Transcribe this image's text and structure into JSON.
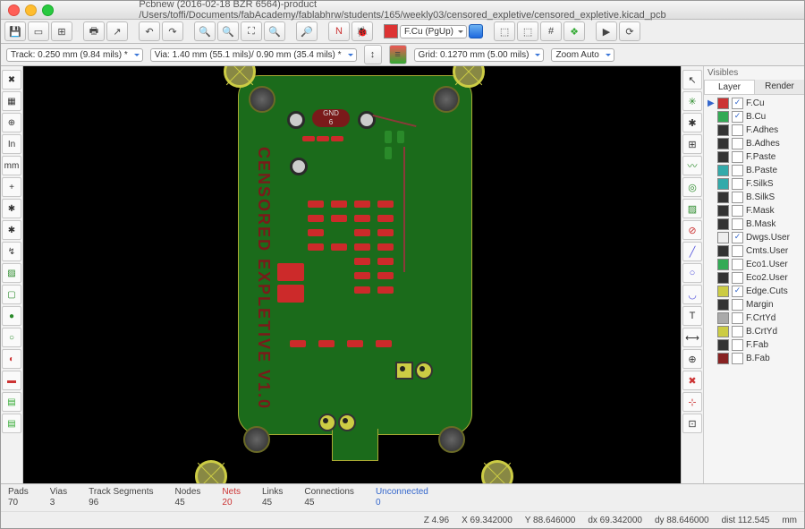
{
  "title": "Pcbnew (2016-02-18 BZR 6564)-product /Users/toffi/Documents/fabAcademy/fablabhrw/students/165/weekly03/censored_expletive/censored_expletive.kicad_pcb",
  "layer_selector": "F.Cu (PgUp)",
  "track_combo": "Track: 0.250 mm (9.84 mils) *",
  "via_combo": "Via: 1.40 mm (55.1 mils)/ 0.90 mm (35.4 mils) *",
  "grid_combo": "Grid: 0.1270 mm (5.00 mils)",
  "zoom_combo": "Zoom Auto",
  "gnd_label_1": "GND",
  "gnd_label_2": "6",
  "board_text": "CENSORED EXPLETIVE V1.0",
  "visibles_title": "Visibles",
  "tab_layer": "Layer",
  "tab_render": "Render",
  "layers": [
    {
      "name": "F.Cu",
      "color": "#cc3333",
      "checked": true,
      "active": true
    },
    {
      "name": "B.Cu",
      "color": "#33aa55",
      "checked": true
    },
    {
      "name": "F.Adhes",
      "color": "#333333",
      "checked": false
    },
    {
      "name": "B.Adhes",
      "color": "#333333",
      "checked": false
    },
    {
      "name": "F.Paste",
      "color": "#333333",
      "checked": false
    },
    {
      "name": "B.Paste",
      "color": "#33aaaa",
      "checked": false
    },
    {
      "name": "F.SilkS",
      "color": "#33aaaa",
      "checked": false
    },
    {
      "name": "B.SilkS",
      "color": "#333333",
      "checked": false
    },
    {
      "name": "F.Mask",
      "color": "#333333",
      "checked": false
    },
    {
      "name": "B.Mask",
      "color": "#333333",
      "checked": false
    },
    {
      "name": "Dwgs.User",
      "color": "#eeeeee",
      "checked": true
    },
    {
      "name": "Cmts.User",
      "color": "#333333",
      "checked": false
    },
    {
      "name": "Eco1.User",
      "color": "#33aa55",
      "checked": false
    },
    {
      "name": "Eco2.User",
      "color": "#333333",
      "checked": false
    },
    {
      "name": "Edge.Cuts",
      "color": "#cccc44",
      "checked": true
    },
    {
      "name": "Margin",
      "color": "#333333",
      "checked": false
    },
    {
      "name": "F.CrtYd",
      "color": "#aaaaaa",
      "checked": false
    },
    {
      "name": "B.CrtYd",
      "color": "#cccc44",
      "checked": false
    },
    {
      "name": "F.Fab",
      "color": "#333333",
      "checked": false
    },
    {
      "name": "B.Fab",
      "color": "#882222",
      "checked": false
    }
  ],
  "status": {
    "pads_l": "Pads",
    "pads_v": "70",
    "vias_l": "Vias",
    "vias_v": "3",
    "trk_l": "Track Segments",
    "trk_v": "96",
    "nodes_l": "Nodes",
    "nodes_v": "45",
    "nets_l": "Nets",
    "nets_v": "20",
    "links_l": "Links",
    "links_v": "45",
    "conn_l": "Connections",
    "conn_v": "45",
    "unc_l": "Unconnected",
    "unc_v": "0"
  },
  "coords": {
    "z": "Z 4.96",
    "x": "X 69.342000",
    "y": "Y 88.646000",
    "dx": "dx 69.342000",
    "dy": "dy 88.646000",
    "dist": "dist 112.545",
    "unit": "mm"
  },
  "unit_label": "mm"
}
